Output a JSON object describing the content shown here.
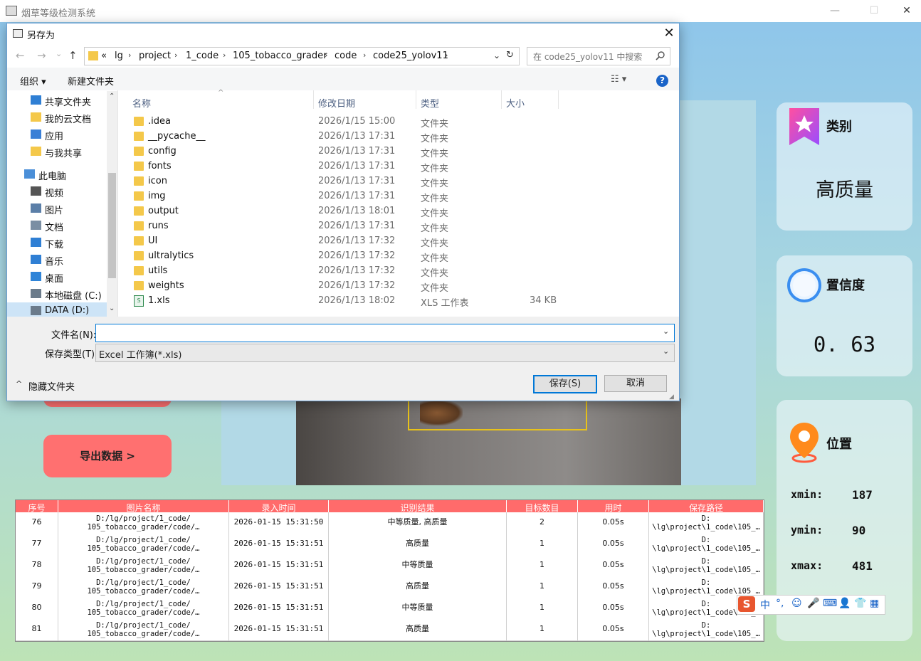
{
  "app": {
    "title": "烟草等级检测系统",
    "minimize": "—",
    "maximize": "☐",
    "close": "✕"
  },
  "cards": {
    "category": {
      "label": "类别",
      "value": "高质量"
    },
    "confidence": {
      "label": "置信度",
      "value": "0. 63"
    },
    "position": {
      "label": "位置",
      "rows": [
        {
          "key": "xmin:",
          "value": "187"
        },
        {
          "key": "ymin:",
          "value": "90"
        },
        {
          "key": "xmax:",
          "value": "481"
        }
      ]
    }
  },
  "buttons": {
    "export": "导出数据 >"
  },
  "table": {
    "headers": [
      "序号",
      "图片名称",
      "录入时间",
      "识别结果",
      "目标数目",
      "用时",
      "保存路径"
    ],
    "rows": [
      {
        "id": "76",
        "name1": "D:/lg/project/1_code/",
        "name2": "105_tobacco_grader/code/…",
        "time": "2026-01-15 15:31:50",
        "result": "中等质量, 高质量",
        "count": "2",
        "cost": "0.05s",
        "path1": "D:",
        "path2": "\\lg\\project\\1_code\\105_…"
      },
      {
        "id": "77",
        "name1": "D:/lg/project/1_code/",
        "name2": "105_tobacco_grader/code/…",
        "time": "2026-01-15 15:31:51",
        "result": "高质量",
        "count": "1",
        "cost": "0.05s",
        "path1": "D:",
        "path2": "\\lg\\project\\1_code\\105_…"
      },
      {
        "id": "78",
        "name1": "D:/lg/project/1_code/",
        "name2": "105_tobacco_grader/code/…",
        "time": "2026-01-15 15:31:51",
        "result": "中等质量",
        "count": "1",
        "cost": "0.05s",
        "path1": "D:",
        "path2": "\\lg\\project\\1_code\\105_…"
      },
      {
        "id": "79",
        "name1": "D:/lg/project/1_code/",
        "name2": "105_tobacco_grader/code/…",
        "time": "2026-01-15 15:31:51",
        "result": "高质量",
        "count": "1",
        "cost": "0.05s",
        "path1": "D:",
        "path2": "\\lg\\project\\1_code\\105_…"
      },
      {
        "id": "80",
        "name1": "D:/lg/project/1_code/",
        "name2": "105_tobacco_grader/code/…",
        "time": "2026-01-15 15:31:51",
        "result": "中等质量",
        "count": "1",
        "cost": "0.05s",
        "path1": "D:",
        "path2": "\\lg\\project\\1_code\\105_…"
      },
      {
        "id": "81",
        "name1": "D:/lg/project/1_code/",
        "name2": "105_tobacco_grader/code/…",
        "time": "2026-01-15 15:31:51",
        "result": "高质量",
        "count": "1",
        "cost": "0.05s",
        "path1": "D:",
        "path2": "\\lg\\project\\1_code\\105_…"
      }
    ]
  },
  "dialog": {
    "title": "另存为",
    "close": "✕",
    "nav": {
      "back": "←",
      "forward": "→",
      "dropdown": "⌄",
      "up": "↑"
    },
    "address": [
      "«",
      "lg",
      "project",
      "1_code",
      "105_tobacco_grader",
      "code",
      "code25_yolov11"
    ],
    "search_placeholder": "在 code25_yolov11 中搜索",
    "toolbar": {
      "organize": "组织 ▾",
      "new_folder": "新建文件夹",
      "help": "?"
    },
    "sidebar": [
      {
        "label": "共享文件夹",
        "icon": "share-icon"
      },
      {
        "label": "我的云文档",
        "icon": "folder-icon"
      },
      {
        "label": "应用",
        "icon": "apps-icon"
      },
      {
        "label": "与我共享",
        "icon": "folder-icon"
      },
      {
        "label": "此电脑",
        "icon": "computer-icon"
      },
      {
        "label": "视频",
        "icon": "video-icon"
      },
      {
        "label": "图片",
        "icon": "picture-icon"
      },
      {
        "label": "文档",
        "icon": "document-icon"
      },
      {
        "label": "下载",
        "icon": "download-icon"
      },
      {
        "label": "音乐",
        "icon": "music-icon"
      },
      {
        "label": "桌面",
        "icon": "desktop-icon"
      },
      {
        "label": "本地磁盘 (C:)",
        "icon": "drive-icon"
      },
      {
        "label": "DATA (D:)",
        "icon": "drive-icon"
      }
    ],
    "columns": [
      "名称",
      "修改日期",
      "类型",
      "大小"
    ],
    "files": [
      {
        "name": ".idea",
        "date": "2026/1/15 15:00",
        "type": "文件夹",
        "size": ""
      },
      {
        "name": "__pycache__",
        "date": "2026/1/13 17:31",
        "type": "文件夹",
        "size": ""
      },
      {
        "name": "config",
        "date": "2026/1/13 17:31",
        "type": "文件夹",
        "size": ""
      },
      {
        "name": "fonts",
        "date": "2026/1/13 17:31",
        "type": "文件夹",
        "size": ""
      },
      {
        "name": "icon",
        "date": "2026/1/13 17:31",
        "type": "文件夹",
        "size": ""
      },
      {
        "name": "img",
        "date": "2026/1/13 17:31",
        "type": "文件夹",
        "size": ""
      },
      {
        "name": "output",
        "date": "2026/1/13 18:01",
        "type": "文件夹",
        "size": ""
      },
      {
        "name": "runs",
        "date": "2026/1/13 17:31",
        "type": "文件夹",
        "size": ""
      },
      {
        "name": "UI",
        "date": "2026/1/13 17:32",
        "type": "文件夹",
        "size": ""
      },
      {
        "name": "ultralytics",
        "date": "2026/1/13 17:32",
        "type": "文件夹",
        "size": ""
      },
      {
        "name": "utils",
        "date": "2026/1/13 17:32",
        "type": "文件夹",
        "size": ""
      },
      {
        "name": "weights",
        "date": "2026/1/13 17:32",
        "type": "文件夹",
        "size": ""
      },
      {
        "name": "1.xls",
        "date": "2026/1/13 18:02",
        "type": "XLS 工作表",
        "size": "34 KB"
      }
    ],
    "filename_label": "文件名(N):",
    "filename_value": "",
    "filetype_label": "保存类型(T):",
    "filetype_value": "Excel 工作簿(*.xls)",
    "hide_folders": "隐藏文件夹",
    "save": "保存(S)",
    "cancel": "取消"
  },
  "ime": [
    "中",
    "°,",
    "☺",
    "🎤",
    "⌨",
    "👤",
    "👕",
    "▦"
  ],
  "colors": {
    "accent": "#ff6b6b",
    "dialog_border": "#6a9fd4",
    "primary_blue": "#0078d7"
  }
}
